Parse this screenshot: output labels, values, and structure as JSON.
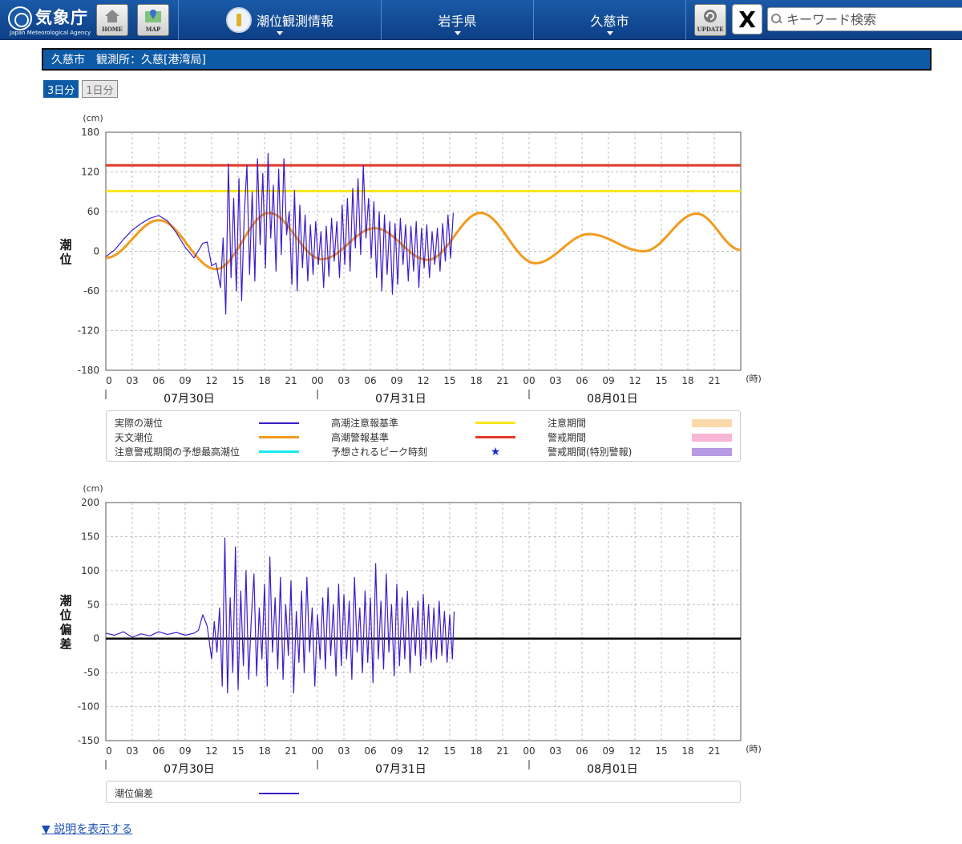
{
  "header": {
    "logo_jp": "気象庁",
    "logo_en": "Japan Meteorological Agency",
    "home_label": "HOME",
    "map_label": "MAP",
    "nav": [
      "潮位観測情報",
      "岩手県",
      "久慈市"
    ],
    "update_label": "UPDATE",
    "x_label": "X",
    "search_placeholder": "キーワード検索"
  },
  "title": "久慈市　観測所：久慈[港湾局]",
  "tabs": [
    "3日分",
    "1日分"
  ],
  "explain_link": "▼ 説明を表示する",
  "colors": {
    "observed": "#3d1cc8",
    "astronomical": "#f39a1d",
    "advisory": "#f5e51b",
    "warning": "#e23a2a",
    "forecast_peak": "#19e8ec",
    "caution_period": "#fbd9a9",
    "warning_period": "#f7b6d6",
    "special_period": "#b69ae2"
  },
  "chart_data": [
    {
      "type": "line",
      "yunit": "(cm)",
      "ylabel": "潮位",
      "xunit": "(時)",
      "ylim": [
        -180,
        180
      ],
      "yticks": [
        180,
        120,
        60,
        0,
        -60,
        -120,
        -180
      ],
      "xlim_hours": [
        0,
        72
      ],
      "xtick_labels": [
        "0",
        "03",
        "06",
        "09",
        "12",
        "15",
        "18",
        "21",
        "00",
        "03",
        "06",
        "09",
        "12",
        "15",
        "18",
        "21",
        "00",
        "03",
        "06",
        "09",
        "12",
        "15",
        "18",
        "21"
      ],
      "date_labels": [
        "07月30日",
        "07月31日",
        "08月01日"
      ],
      "grid": true,
      "thresholds": {
        "advisory": 91,
        "warning": 130
      },
      "astronomical": {
        "x": [
          0,
          6,
          12.5,
          18.5,
          24.5,
          30.5,
          36.5,
          42.5,
          48.7,
          54.8,
          61,
          67,
          72
        ],
        "y": [
          -10,
          47,
          -27,
          58,
          -12,
          35,
          -13,
          58,
          -18,
          26,
          0,
          57,
          2
        ]
      },
      "observed": {
        "x": [
          0,
          1,
          2,
          3,
          4,
          5,
          6,
          7,
          8,
          9,
          10,
          11,
          11.5,
          12,
          12.5,
          13,
          13.3,
          13.6,
          13.9,
          14.2,
          14.5,
          14.8,
          15.1,
          15.4,
          15.7,
          16,
          16.3,
          16.6,
          16.9,
          17.2,
          17.5,
          17.8,
          18.1,
          18.4,
          18.7,
          19,
          19.3,
          19.6,
          19.9,
          20.2,
          20.5,
          20.8,
          21.1,
          21.4,
          21.7,
          22,
          22.3,
          22.6,
          22.9,
          23.2,
          23.5,
          23.8,
          24.1,
          24.4,
          24.7,
          25,
          25.3,
          25.6,
          25.9,
          26.2,
          26.5,
          26.8,
          27.1,
          27.4,
          27.7,
          28,
          28.3,
          28.6,
          28.9,
          29.2,
          29.5,
          29.8,
          30.1,
          30.4,
          30.7,
          31,
          31.3,
          31.6,
          31.9,
          32.2,
          32.5,
          32.8,
          33.1,
          33.4,
          33.7,
          34,
          34.3,
          34.6,
          34.9,
          35.2,
          35.5,
          35.8,
          36.1,
          36.4,
          36.7,
          37,
          37.3,
          37.6,
          37.9,
          38.2,
          38.5,
          38.8,
          39.1,
          39.4
        ],
        "y": [
          -8,
          2,
          18,
          32,
          42,
          50,
          54,
          46,
          28,
          6,
          -10,
          12,
          14,
          -22,
          -18,
          -55,
          20,
          -95,
          132,
          -40,
          80,
          -60,
          110,
          -75,
          55,
          130,
          -35,
          90,
          -45,
          140,
          10,
          118,
          -25,
          148,
          20,
          100,
          -30,
          124,
          -5,
          140,
          25,
          60,
          -50,
          92,
          -60,
          70,
          -25,
          55,
          -45,
          40,
          -35,
          45,
          -20,
          30,
          -55,
          38,
          -38,
          50,
          -15,
          45,
          -40,
          70,
          -20,
          80,
          -30,
          95,
          5,
          110,
          -5,
          130,
          20,
          80,
          -10,
          75,
          -40,
          60,
          -60,
          55,
          -35,
          45,
          -65,
          42,
          -50,
          50,
          -20,
          40,
          -45,
          38,
          -30,
          45,
          -55,
          35,
          -25,
          40,
          -40,
          30,
          -20,
          35,
          -30,
          42,
          -15,
          55,
          -10,
          58
        ]
      }
    },
    {
      "type": "line",
      "yunit": "(cm)",
      "ylabel": "潮位偏差",
      "xunit": "(時)",
      "ylim": [
        -150,
        200
      ],
      "yticks": [
        200,
        150,
        100,
        50,
        0,
        -50,
        -100,
        -150
      ],
      "xlim_hours": [
        0,
        72
      ],
      "xtick_labels": [
        "0",
        "03",
        "06",
        "09",
        "12",
        "15",
        "18",
        "21",
        "00",
        "03",
        "06",
        "09",
        "12",
        "15",
        "18",
        "21",
        "00",
        "03",
        "06",
        "09",
        "12",
        "15",
        "18",
        "21"
      ],
      "date_labels": [
        "07月30日",
        "07月31日",
        "08月01日"
      ],
      "grid": true,
      "deviation": {
        "x": [
          0,
          1,
          2,
          3,
          4,
          5,
          6,
          7,
          8,
          9,
          10,
          10.5,
          11,
          11.5,
          12,
          12.3,
          12.6,
          12.9,
          13.2,
          13.5,
          13.8,
          14.1,
          14.4,
          14.7,
          15,
          15.3,
          15.6,
          15.9,
          16.2,
          16.5,
          16.8,
          17.1,
          17.4,
          17.7,
          18,
          18.3,
          18.6,
          18.9,
          19.2,
          19.5,
          19.8,
          20.1,
          20.4,
          20.7,
          21,
          21.3,
          21.6,
          21.9,
          22.2,
          22.5,
          22.8,
          23.1,
          23.4,
          23.7,
          24,
          24.3,
          24.6,
          24.9,
          25.2,
          25.5,
          25.8,
          26.1,
          26.4,
          26.7,
          27,
          27.3,
          27.6,
          27.9,
          28.2,
          28.5,
          28.8,
          29.1,
          29.4,
          29.7,
          30,
          30.3,
          30.6,
          30.9,
          31.2,
          31.5,
          31.8,
          32.1,
          32.4,
          32.7,
          33,
          33.3,
          33.6,
          33.9,
          34.2,
          34.5,
          34.8,
          35.1,
          35.4,
          35.7,
          36,
          36.3,
          36.6,
          36.9,
          37.2,
          37.5,
          37.8,
          38.1,
          38.4,
          38.7,
          39,
          39.3,
          39.5
        ],
        "y": [
          8,
          5,
          10,
          2,
          7,
          4,
          10,
          6,
          9,
          5,
          8,
          12,
          35,
          18,
          -30,
          25,
          -20,
          45,
          -70,
          148,
          -80,
          60,
          -50,
          135,
          -75,
          70,
          -40,
          100,
          -60,
          30,
          95,
          -55,
          45,
          -30,
          80,
          -70,
          120,
          -20,
          60,
          -45,
          90,
          -60,
          50,
          -25,
          85,
          -80,
          40,
          -35,
          70,
          -50,
          90,
          -20,
          45,
          -70,
          35,
          -30,
          60,
          -45,
          75,
          -25,
          50,
          -55,
          80,
          -40,
          65,
          -30,
          55,
          -60,
          90,
          -20,
          45,
          -50,
          70,
          -35,
          60,
          -65,
          110,
          -30,
          55,
          -45,
          95,
          -20,
          50,
          -55,
          80,
          -40,
          60,
          -30,
          70,
          -50,
          45,
          -25,
          55,
          -40,
          65,
          -30,
          50,
          -35,
          45,
          -30,
          55,
          -25,
          40,
          -35,
          35,
          -30,
          40
        ]
      }
    }
  ],
  "legend_top": {
    "observed": "実際の潮位",
    "astronomical": "天文潮位",
    "forecast_peak": "注意警戒期間の予想最高潮位",
    "advisory": "高潮注意報基準",
    "warning": "高潮警報基準",
    "peak_time": "予想されるピーク時刻",
    "caution_period": "注意期間",
    "warning_period": "警戒期間",
    "special_period": "警戒期間(特別警報)",
    "star": "★"
  },
  "legend_bottom": {
    "deviation": "潮位偏差"
  }
}
